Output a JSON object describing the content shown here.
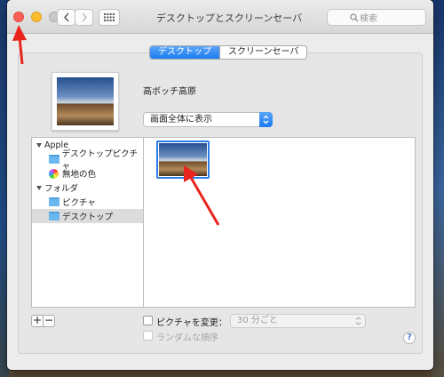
{
  "window": {
    "title": "デスクトップとスクリーンセーバ",
    "search_placeholder": "検索"
  },
  "tabs": [
    {
      "label": "デスクトップ",
      "active": true
    },
    {
      "label": "スクリーンセーバ",
      "active": false
    }
  ],
  "current": {
    "photo_name": "高ボッチ高原",
    "fit_option": "画面全体に表示"
  },
  "sidebar": {
    "groups": [
      {
        "label": "Apple",
        "items": [
          {
            "label": "デスクトップピクチャ",
            "icon": "folder-icon"
          },
          {
            "label": "無地の色",
            "icon": "color-wheel-icon"
          }
        ]
      },
      {
        "label": "フォルダ",
        "items": [
          {
            "label": "ピクチャ",
            "icon": "folder-icon"
          },
          {
            "label": "デスクトップ",
            "icon": "folder-icon",
            "selected": true
          }
        ]
      }
    ],
    "add_label": "+",
    "remove_label": "−"
  },
  "options": {
    "change_picture_label": "ピクチャを変更：",
    "change_picture_checked": false,
    "interval": "30 分ごと",
    "random_order_label": "ランダムな順序",
    "random_order_checked": false
  },
  "help_label": "?",
  "colors": {
    "accent": "#1c7cf0",
    "annotation_arrow": "#e8241c"
  }
}
